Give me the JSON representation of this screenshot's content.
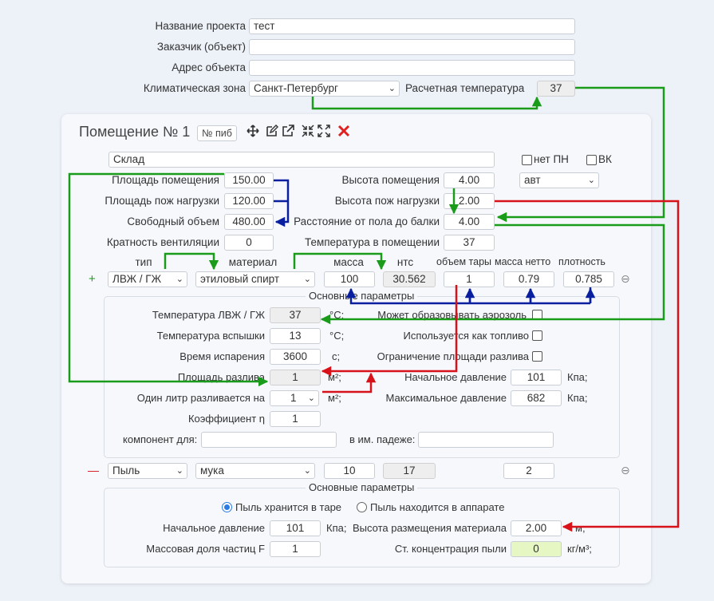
{
  "project": {
    "name_label": "Название проекта",
    "name_value": "тест",
    "customer_label": "Заказчик (объект)",
    "customer_value": "",
    "address_label": "Адрес объекта",
    "address_value": "",
    "zone_label": "Климатическая зона",
    "zone_value": "Санкт-Петербург",
    "temp_label": "Расчетная температура",
    "temp_value": "37"
  },
  "room": {
    "title": "Помещение № 1",
    "num_placeholder": "№ пиб",
    "name_value": "Склад",
    "no_pn_label": "нет ПН",
    "vk_label": "ВК",
    "area_label": "Площадь помещения",
    "area_value": "150.00",
    "fire_load_area_label": "Площадь пож нагрузки",
    "fire_load_area_value": "120.00",
    "free_volume_label": "Свободный объем",
    "free_volume_value": "480.00",
    "ventilation_label": "Кратность вентиляции",
    "ventilation_value": "0",
    "height_label": "Высота помещения",
    "height_value": "4.00",
    "height_mode": "авт",
    "fire_load_height_label": "Высота пож нагрузки",
    "fire_load_height_value": "2.00",
    "beam_distance_label": "Расстояние от пола до балки",
    "beam_distance_value": "4.00",
    "room_temp_label": "Температура в помещении",
    "room_temp_value": "37"
  },
  "substances_header": {
    "type": "тип",
    "material": "материал",
    "mass": "масса",
    "nts": "нтс",
    "tare_volume": "объем тары",
    "net_mass": "масса нетто",
    "density": "плотность"
  },
  "substance1": {
    "toggle": "+",
    "type": "ЛВЖ / ГЖ",
    "material": "этиловый спирт",
    "mass": "100",
    "nts": "30.562",
    "tare_volume": "1",
    "net_mass": "0.79",
    "density": "0.785",
    "params_legend": "Основные параметры",
    "liquid_temp_label": "Температура ЛВЖ / ГЖ",
    "liquid_temp_value": "37",
    "liquid_temp_unit": "°C;",
    "flash_temp_label": "Температура вспышки",
    "flash_temp_value": "13",
    "flash_temp_unit": "°C;",
    "evap_time_label": "Время испарения",
    "evap_time_value": "3600",
    "evap_time_unit": "с;",
    "spill_area_label": "Площадь разлива",
    "spill_area_value": "1",
    "spill_area_unit": "м²;",
    "liter_spill_label": "Один литр разливается на",
    "liter_spill_value": "1",
    "liter_spill_unit": "м²;",
    "coef_label": "Коэффициент η",
    "coef_value": "1",
    "component_label": "компонент для:",
    "component_value": "",
    "case_label": "в им. падеже:",
    "case_value": "",
    "aerosol_label": "Может образовывать аэрозоль",
    "fuel_label": "Используется как топливо",
    "spill_limit_label": "Ограничение площади разлива",
    "init_pressure_label": "Начальное давление",
    "init_pressure_value": "101",
    "init_pressure_unit": "Кпа;",
    "max_pressure_label": "Максимальное давление",
    "max_pressure_value": "682",
    "max_pressure_unit": "Кпа;"
  },
  "substance2": {
    "toggle": "—",
    "type": "Пыль",
    "material": "мука",
    "mass": "10",
    "nts": "17",
    "net_mass": "2",
    "params_legend": "Основные параметры",
    "radio_tare_label": "Пыль хранится в таре",
    "radio_apparatus_label": "Пыль находится в аппарате",
    "init_pressure_label": "Начальное давление",
    "init_pressure_value": "101",
    "init_pressure_unit": "Кпа;",
    "mass_fraction_label": "Массовая доля частиц F",
    "mass_fraction_value": "1",
    "height_label": "Высота размещения материала",
    "height_value": "2.00",
    "height_unit": "м;",
    "concentration_label": "Ст. концентрация пыли",
    "concentration_value": "0",
    "concentration_unit": "кг/м³;"
  },
  "icons": [
    "move-icon",
    "edit-icon",
    "external-link-icon",
    "collapse-icon",
    "expand-icon",
    "delete-icon",
    "remove-row-icon",
    "chevron-down-icon"
  ],
  "colors": {
    "arrow_green": "#1a9c1a",
    "arrow_blue": "#0a1fa0",
    "arrow_red": "#d8121b",
    "delete_red": "#e02020",
    "highlight_green": "#e6f7c4"
  }
}
